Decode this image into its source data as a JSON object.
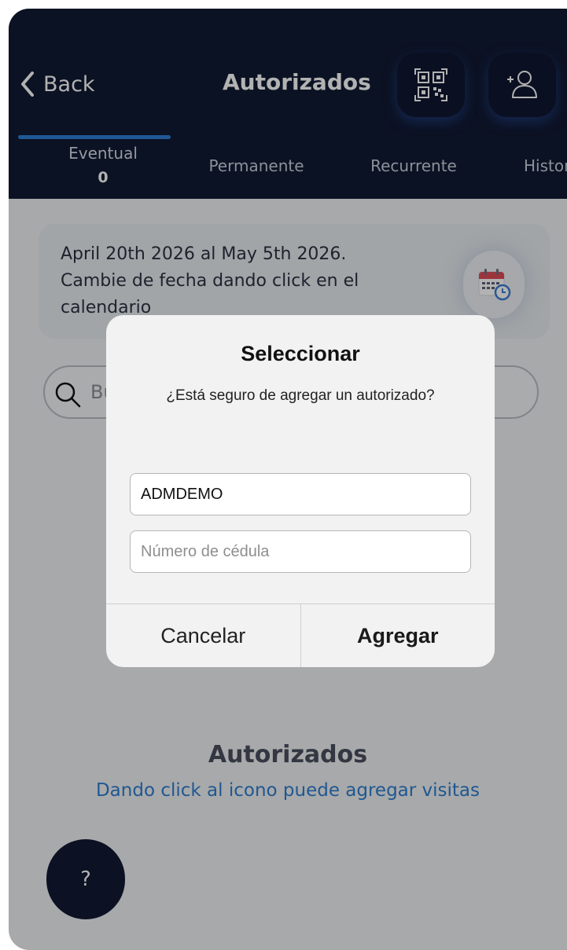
{
  "header": {
    "back_label": "Back",
    "title": "Autorizados",
    "icons": [
      "qr-code-icon",
      "add-user-icon"
    ]
  },
  "tabs": [
    {
      "label": "Eventual",
      "count": "0",
      "active": true
    },
    {
      "label": "Permanente"
    },
    {
      "label": "Recurrente"
    },
    {
      "label": "Historial"
    }
  ],
  "date_card": {
    "text": "April 20th 2026 al May 5th 2026. Cambie de fecha dando click en el calendario",
    "icon": "calendar-icon"
  },
  "search": {
    "placeholder": "Buscar",
    "icon": "search-icon"
  },
  "empty_state": {
    "title": "Autorizados",
    "subtitle": "Dando click al icono puede agregar visitas"
  },
  "help_button": {
    "label": "?"
  },
  "dialog": {
    "title": "Seleccionar",
    "message": "¿Está seguro de agregar un autorizado?",
    "name_value": "ADMDEMO",
    "cedula_placeholder": "Número de cédula",
    "cancel_label": "Cancelar",
    "confirm_label": "Agregar"
  },
  "colors": {
    "header_bg": "#111a33",
    "accent": "#2f7fd6",
    "link_blue": "#2e7ed0",
    "overlay": "rgba(0,0,0,0.30)"
  }
}
